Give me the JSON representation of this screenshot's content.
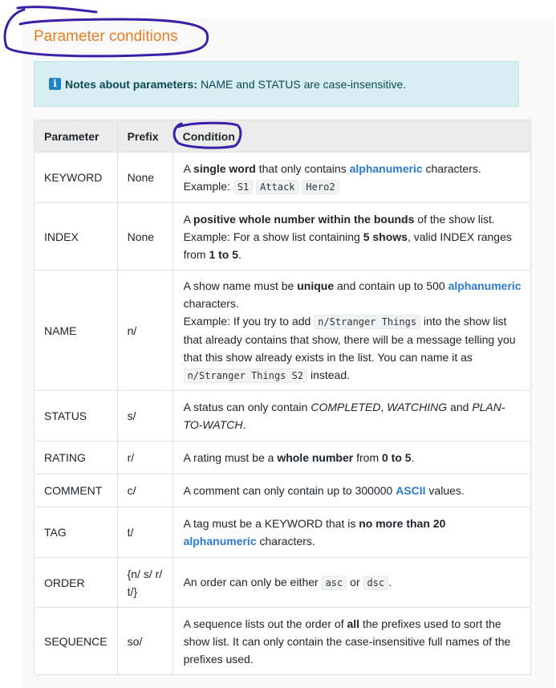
{
  "section_title": "Parameter conditions",
  "note": {
    "icon": "info-icon",
    "label": "Notes about parameters:",
    "text": "NAME and STATUS are case-insensitive."
  },
  "table": {
    "headers": [
      "Parameter",
      "Prefix",
      "Condition"
    ],
    "rows": [
      {
        "param": "KEYWORD",
        "prefix": "None",
        "condition": {
          "t1": "A ",
          "b1": "single word",
          "t2": " that only contains ",
          "link": "alphanumeric",
          "t3": " characters.",
          "t4": "Example: ",
          "codes": [
            "S1",
            "Attack",
            "Hero2"
          ]
        }
      },
      {
        "param": "INDEX",
        "prefix": "None",
        "condition": {
          "t1": "A ",
          "b1": "positive whole number within the bounds",
          "t2": " of the show list.",
          "t3": "Example: For a show list containing ",
          "b2": "5 shows",
          "t4": ", valid INDEX ranges from ",
          "b3": "1 to 5",
          "t5": "."
        }
      },
      {
        "param": "NAME",
        "prefix": "n/",
        "condition": {
          "t1": "A show name must be ",
          "b1": "unique",
          "t2": " and contain up to 500 ",
          "link": "alphanumeric",
          "t3": " characters.",
          "t4": "Example: If you try to add ",
          "code1": "n/Stranger Things",
          "t5": " into the show list that already contains that show, there will be a message telling you that this show already exists in the list. You can name it as ",
          "code2": "n/Stranger Things S2",
          "t6": " instead."
        }
      },
      {
        "param": "STATUS",
        "prefix": "s/",
        "condition": {
          "t1": "A status can only contain ",
          "i1": "COMPLETED",
          "t2": ", ",
          "i2": "WATCHING",
          "t3": " and ",
          "i3": "PLAN-TO-WATCH",
          "t4": "."
        }
      },
      {
        "param": "RATING",
        "prefix": "r/",
        "condition": {
          "t1": "A rating must be a ",
          "b1": "whole number",
          "t2": " from ",
          "b2": "0 to 5",
          "t3": "."
        }
      },
      {
        "param": "COMMENT",
        "prefix": "c/",
        "condition": {
          "t1": "A comment can only contain up to 300000 ",
          "link": "ASCII",
          "t2": " values."
        }
      },
      {
        "param": "TAG",
        "prefix": "t/",
        "condition": {
          "t1": "A tag must be a KEYWORD that is ",
          "b1": "no more than 20",
          "t2": " ",
          "link": "alphanumeric",
          "t3": " characters."
        }
      },
      {
        "param": "ORDER",
        "prefix": "{n/ s/ r/ t/}",
        "condition": {
          "t1": "An order can only be either ",
          "code1": "asc",
          "t2": " or ",
          "code2": "dsc",
          "t3": "."
        }
      },
      {
        "param": "SEQUENCE",
        "prefix": "so/",
        "condition": {
          "t1": "A sequence lists out the order of ",
          "b1": "all",
          "t2": " the prefixes used to sort the show list. It can only contain the case-insensitive full names of the prefixes used."
        }
      }
    ]
  },
  "colors": {
    "heading": "#e67e22",
    "link": "#2b7bd0",
    "annotation": "#3b1fa8",
    "note_bg": "#d7eef2"
  }
}
